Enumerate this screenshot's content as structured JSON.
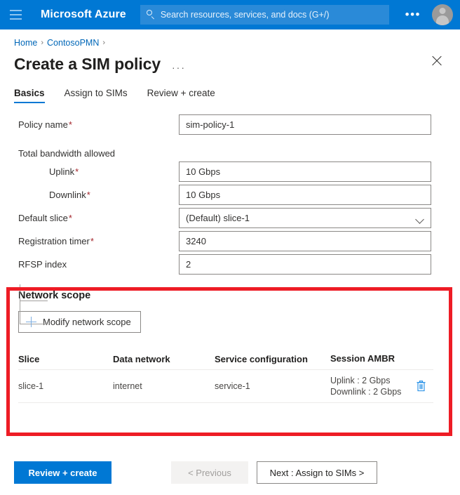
{
  "topbar": {
    "menu_icon": "hamburger-icon",
    "brand": "Microsoft Azure",
    "search_placeholder": "Search resources, services, and docs (G+/)",
    "search_value": "",
    "search_icon": "search-icon",
    "more_label": "•••",
    "avatar_icon": "user-avatar-icon"
  },
  "breadcrumb": {
    "items": [
      {
        "label": "Home"
      },
      {
        "label": "ContosoPMN"
      }
    ],
    "separator": "›",
    "trailing_separator": "›"
  },
  "header": {
    "title": "Create a SIM policy",
    "more_label": "···",
    "close_icon": "close-icon"
  },
  "tabs": [
    {
      "label": "Basics",
      "active": true
    },
    {
      "label": "Assign to SIMs",
      "active": false
    },
    {
      "label": "Review + create",
      "active": false
    }
  ],
  "form": {
    "fields": [
      {
        "label": "Policy name",
        "required": true,
        "value": "sim-policy-1",
        "type": "text"
      },
      {
        "label": "Total bandwidth allowed",
        "required": false,
        "type": "group-header"
      },
      {
        "label": "Uplink",
        "required": true,
        "value": "10 Gbps",
        "type": "text"
      },
      {
        "label": "Downlink",
        "required": true,
        "value": "10 Gbps",
        "type": "text"
      },
      {
        "label": "Default slice",
        "required": true,
        "value": "(Default) slice-1",
        "type": "select"
      },
      {
        "label": "Registration timer",
        "required": true,
        "value": "3240",
        "type": "text"
      },
      {
        "label": "RFSP index",
        "required": false,
        "value": "2",
        "type": "text"
      }
    ],
    "required_marker": "*"
  },
  "network_scope": {
    "section_title": "Network scope",
    "modify_button_label": "Modify network scope",
    "add_icon": "plus-icon",
    "highlight_color": "#ee1c25",
    "table": {
      "columns": [
        "Slice",
        "Data network",
        "Service configuration",
        "Session AMBR"
      ],
      "rows": [
        {
          "slice": "slice-1",
          "data_network": "internet",
          "service_configuration": "service-1",
          "session_ambr_uplink": "Uplink : 2 Gbps",
          "session_ambr_downlink": "Downlink : 2 Gbps",
          "delete_icon": "trash-icon"
        }
      ]
    }
  },
  "footer": {
    "review_create_label": "Review + create",
    "previous_label": "< Previous",
    "next_label": "Next : Assign to SIMs >"
  },
  "colors": {
    "accent": "#0078d4",
    "link": "#0067b8",
    "required": "#a4262c",
    "highlight": "#ee1c25",
    "trash": "#1a8ae5"
  }
}
